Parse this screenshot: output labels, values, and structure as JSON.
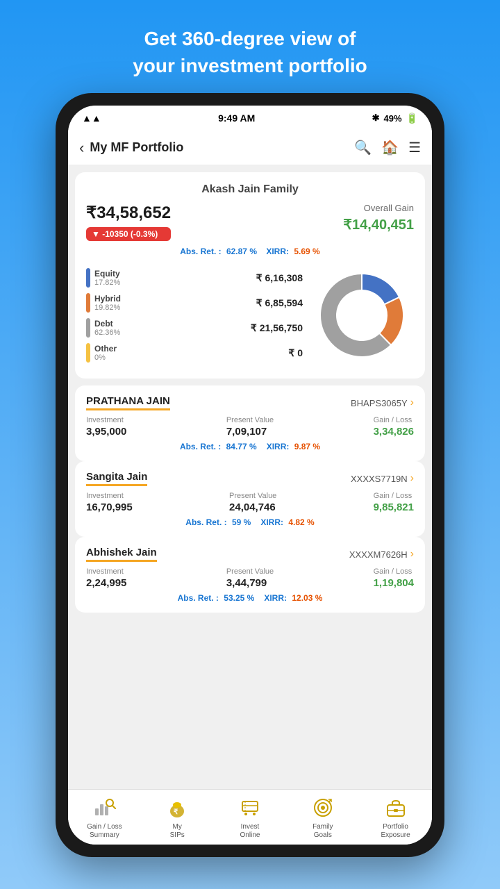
{
  "header": {
    "line1": "Get 360-degree view of",
    "line2": "your investment portfolio"
  },
  "status_bar": {
    "time": "9:49 AM",
    "battery": "49%"
  },
  "nav": {
    "back_label": "‹",
    "title": "My MF Portfolio"
  },
  "portfolio": {
    "family_name": "Akash Jain Family",
    "total_value": "₹34,58,652",
    "change_badge": "▼ -10350  (-0.3%)",
    "overall_gain_label": "Overall Gain",
    "overall_gain_value": "₹14,40,451",
    "abs_ret_label": "Abs. Ret. :",
    "abs_ret_value": "62.87 %",
    "xirr_label": "XIRR:",
    "xirr_value": "5.69 %",
    "categories": [
      {
        "name": "Equity",
        "pct": "17.82%",
        "value": "₹ 6,16,308",
        "color": "#4472c4"
      },
      {
        "name": "Hybrid",
        "pct": "19.82%",
        "value": "₹ 6,85,594",
        "color": "#e07b39"
      },
      {
        "name": "Debt",
        "pct": "62.36%",
        "value": "₹ 21,56,750",
        "color": "#a0a0a0"
      },
      {
        "name": "Other",
        "pct": "0%",
        "value": "₹ 0",
        "color": "#f5c242"
      }
    ],
    "donut": {
      "segments": [
        {
          "label": "Equity",
          "pct": 17.82,
          "color": "#4472c4"
        },
        {
          "label": "Hybrid",
          "pct": 19.82,
          "color": "#e07b39"
        },
        {
          "label": "Debt",
          "pct": 62.36,
          "color": "#a0a0a0"
        }
      ]
    }
  },
  "members": [
    {
      "name": "PRATHANA JAIN",
      "id": "BHAPS3065Y",
      "investment": "3,95,000",
      "present_value": "7,09,107",
      "gain_loss": "3,34,826",
      "abs_ret_value": "84.77 %",
      "xirr_value": "9.87 %"
    },
    {
      "name": "Sangita Jain",
      "id": "XXXXS7719N",
      "investment": "16,70,995",
      "present_value": "24,04,746",
      "gain_loss": "9,85,821",
      "abs_ret_value": "59 %",
      "xirr_value": "4.82 %"
    },
    {
      "name": "Abhishek Jain",
      "id": "XXXXM7626H",
      "investment": "2,24,995",
      "present_value": "3,44,799",
      "gain_loss": "1,19,804",
      "abs_ret_value": "53.25 %",
      "xirr_value": "12.03 %"
    }
  ],
  "tab_bar": {
    "items": [
      {
        "label": "Gain / Loss\nSummary",
        "icon": "gain_loss"
      },
      {
        "label": "My\nSIPs",
        "icon": "my_sips"
      },
      {
        "label": "Invest\nOnline",
        "icon": "invest_online"
      },
      {
        "label": "Family\nGoals",
        "icon": "family_goals"
      },
      {
        "label": "Portfolio\nExposure",
        "icon": "portfolio_exposure"
      }
    ]
  },
  "labels": {
    "investment": "Investment",
    "present_value": "Present Value",
    "gain_loss": "Gain / Loss",
    "abs_ret": "Abs. Ret. :",
    "xirr": "XIRR:"
  }
}
